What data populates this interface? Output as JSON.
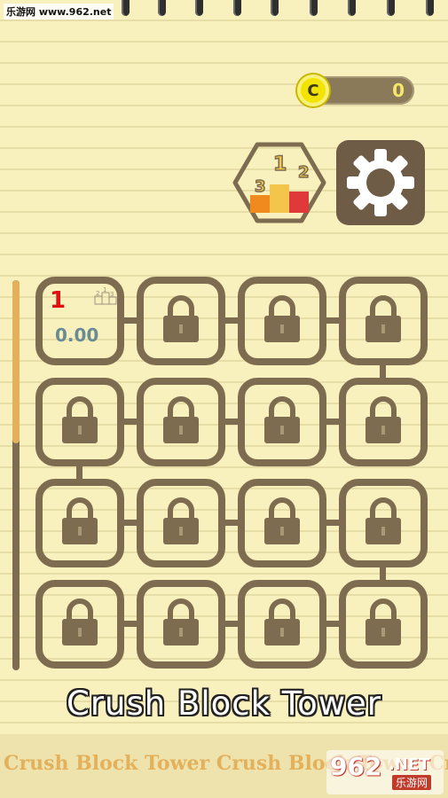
{
  "watermark_top": "乐游网 www.962.net",
  "coins": {
    "icon_letter": "C",
    "count": "0"
  },
  "buttons": {
    "leaderboard": "leaderboard-icon",
    "settings": "gear-icon"
  },
  "levels": [
    {
      "number": "1",
      "time": "0.00",
      "state": "unlocked",
      "podium": [
        "2",
        "1",
        "3"
      ]
    },
    {
      "state": "locked"
    },
    {
      "state": "locked"
    },
    {
      "state": "locked"
    },
    {
      "state": "locked"
    },
    {
      "state": "locked"
    },
    {
      "state": "locked"
    },
    {
      "state": "locked"
    },
    {
      "state": "locked"
    },
    {
      "state": "locked"
    },
    {
      "state": "locked"
    },
    {
      "state": "locked"
    },
    {
      "state": "locked"
    },
    {
      "state": "locked"
    },
    {
      "state": "locked"
    },
    {
      "state": "locked"
    }
  ],
  "leaderboard_podium": {
    "left": "3",
    "center": "1",
    "right": "2"
  },
  "title": "Crush Block Tower",
  "banner": {
    "text": "Crush Block Tower    Crush Block Tower    Crush Block Tower"
  },
  "badge": {
    "digits": "962",
    "suffix": ".NET",
    "cn": "乐游网"
  },
  "colors": {
    "paper": "#f8f0bd",
    "tile_border": "#7d6c4f",
    "coin": "#f3e400",
    "level_number": "#e01010",
    "level_time": "#6a8a94",
    "accent_orange": "#e3b15c"
  }
}
